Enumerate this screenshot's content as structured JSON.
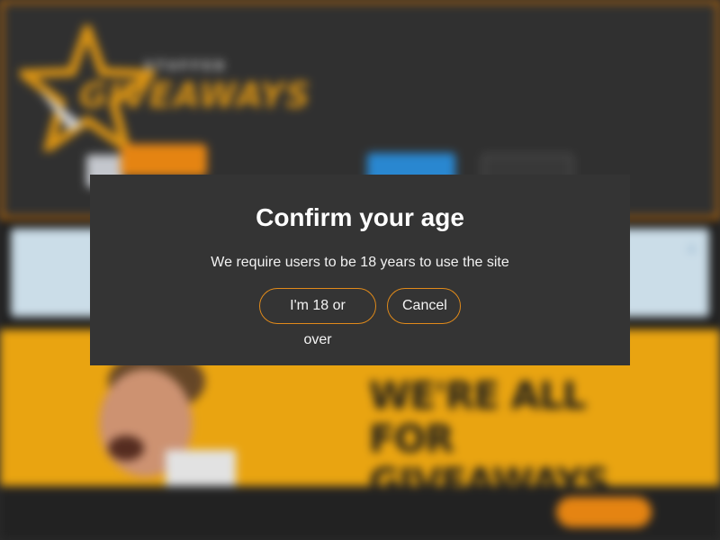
{
  "header": {
    "logo_small": "STUFFED",
    "logo_big": "GIVEAWAYS",
    "meta_line1": "",
    "meta_line2": "",
    "submit_label": "",
    "signup_label": "",
    "login_label": ""
  },
  "notice": {
    "title": "",
    "text": "",
    "close_glyph": "×"
  },
  "hero": {
    "headline": "WE'RE ALL FOR GIVEAWAYS"
  },
  "cookie": {
    "text": "",
    "link": "",
    "accept_label": ""
  },
  "modal": {
    "title": "Confirm your age",
    "message": "We require users to be 18 years to use the site",
    "confirm_label": "I'm 18 or over",
    "cancel_label": "Cancel"
  },
  "colors": {
    "accent_orange": "#e08a1a",
    "header_bg": "#333333",
    "modal_bg": "#343434",
    "hero_bg": "#f6ad12",
    "notice_bg": "#d6e9f5",
    "primary_blue": "#2c8fdc"
  },
  "icons": {
    "logo": "star-logo-icon",
    "language": "flag-icon",
    "close": "close-icon"
  }
}
